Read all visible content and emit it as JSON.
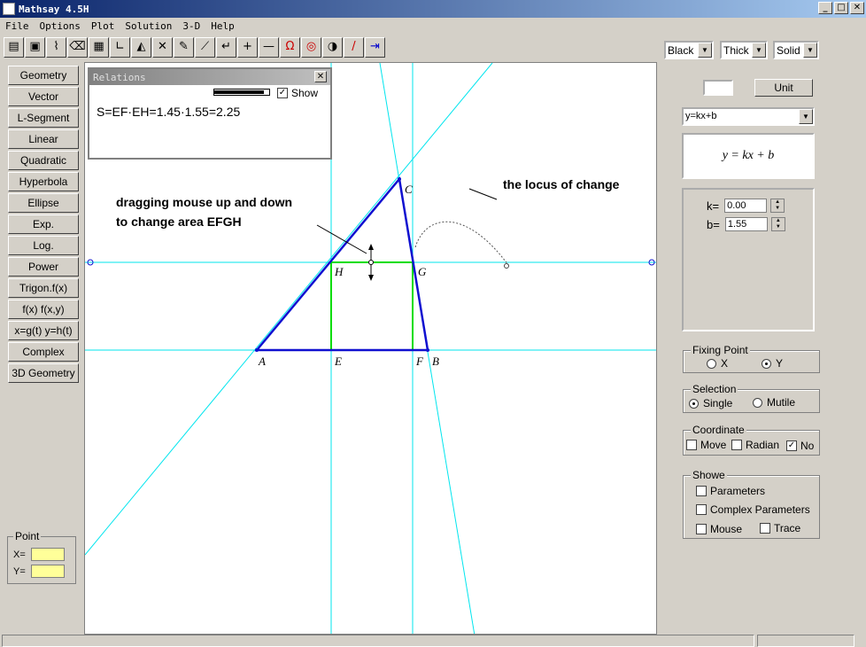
{
  "window": {
    "title": "Mathsay 4.5H",
    "controls": [
      "_",
      "□",
      "✕"
    ]
  },
  "menu": [
    "File",
    "Options",
    "Plot",
    "Solution",
    "3-D",
    "Help"
  ],
  "toolbar_icons": [
    "open-icon",
    "save-icon",
    "graph-icon",
    "erase-icon",
    "grid-icon",
    "angle-icon",
    "triangle-icon",
    "intersect-icon",
    "pen-icon",
    "segment-icon",
    "arrow-icon",
    "plus-icon",
    "minus-icon",
    "magnet-icon",
    "target-icon",
    "contrast-icon",
    "pencil-icon",
    "exit-icon"
  ],
  "style_selectors": {
    "color": "Black",
    "thickness": "Thick",
    "line_style": "Solid"
  },
  "left_buttons": [
    "Geometry",
    "Vector",
    "L-Segment",
    "Linear",
    "Quadratic",
    "Hyperbola",
    "Ellipse",
    "Exp.",
    "Log.",
    "Power",
    "Trigon.f(x)",
    "f(x)  f(x,y)",
    "x=g(t) y=h(t)",
    "Complex",
    "3D Geometry"
  ],
  "point": {
    "title": "Point",
    "x_label": "X=",
    "y_label": "Y=",
    "x_value": "",
    "y_value": ""
  },
  "relations": {
    "title": "Relations",
    "show_label": "Show",
    "show_checked": true,
    "formula": "S=EF·EH=1.45·1.55=2.25",
    "slider_level": 0.9
  },
  "annotations": {
    "drag_line1": "dragging mouse up and down",
    "drag_line2": "to change area EFGH",
    "locus": "the locus of change"
  },
  "points": {
    "A": "A",
    "B": "B",
    "C": "C",
    "E": "E",
    "F": "F",
    "G": "G",
    "H": "H"
  },
  "right_panel": {
    "unit_value": "",
    "unit_button": "Unit",
    "function_select": "y=kx+b",
    "formula": "y = kx + b",
    "params": [
      {
        "label": "k=",
        "value": "0.00"
      },
      {
        "label": "b=",
        "value": "1.55"
      }
    ],
    "fixing_point": {
      "title": "Fixing Point",
      "options": [
        "X",
        "Y"
      ],
      "selected": "Y"
    },
    "selection": {
      "title": "Selection",
      "options": [
        "Single",
        "Mutile"
      ],
      "selected": "Single"
    },
    "coordinate": {
      "title": "Coordinate",
      "move": "Move",
      "radian": "Radian",
      "no": "No",
      "move_checked": false,
      "radian_checked": false,
      "no_checked": true
    },
    "showe": {
      "title": "Showe",
      "parameters": "Parameters",
      "complex_parameters": "Complex Parameters",
      "mouse": "Mouse",
      "trace": "Trace"
    }
  },
  "colors": {
    "cyan_line": "#00e5ee",
    "triangle": "#1010d0",
    "rectangle": "#00dd00",
    "canvas": "#ffffff",
    "panel": "#d4d0c8"
  }
}
